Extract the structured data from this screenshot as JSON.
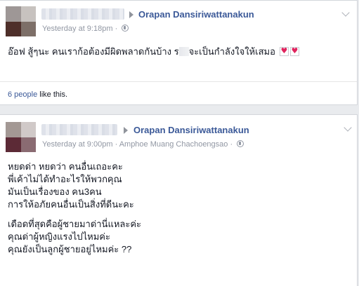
{
  "post1": {
    "author": "Orapan Dansiriwattanakun",
    "timestamp": "Yesterday at 9:18pm",
    "separator": "·",
    "text_before": "อ๊อฟ สู้ๆนะ คนเราก้อต้องมีผิดพลาดกันบ้าง ร",
    "text_after": "จะเป็นกำลังใจให้เสมอ",
    "likes_count": "6 people",
    "likes_suffix": " like this.",
    "avatar_colors": [
      "#9e9796",
      "#c7c2bf",
      "#4e2f2a",
      "#7d6f68"
    ]
  },
  "post2": {
    "author": "Orapan Dansiriwattanakun",
    "timestamp": "Yesterday at 9:00pm",
    "separator": "·",
    "location": "Amphoe Muang Chachoengsao",
    "lines": [
      "หยดด่า หยดว่า คนอื่นเถอะคะ",
      "พี่เค้าไม่ได้ทำอะไรให้พวกคุณ",
      "มันเป็นเรื่องของ คน3คน",
      "การให้อภัยคนอื่นเป็นสิ่งที่ดีนะคะ",
      "เดือดที่สุดคือผู้ชายมาด่านี่แหละค่ะ",
      "คุณด่าผู้หญิงแรงไปไหมค่ะ",
      "คุณยังเป็นลูกผู้ชายอยู่ไหมค่ะ ??"
    ],
    "avatar_colors": [
      "#a39894",
      "#d0c9c8",
      "#5c2a36",
      "#8a6b72"
    ]
  },
  "icons": {
    "privacy": "globe-icon",
    "options": "chevron-down-icon",
    "arrow": "triangle-right-icon",
    "reaction": "heart-emoji-icon"
  },
  "colors": {
    "link": "#3b5998",
    "meta": "#9197a3",
    "heart": "#e0245e"
  }
}
